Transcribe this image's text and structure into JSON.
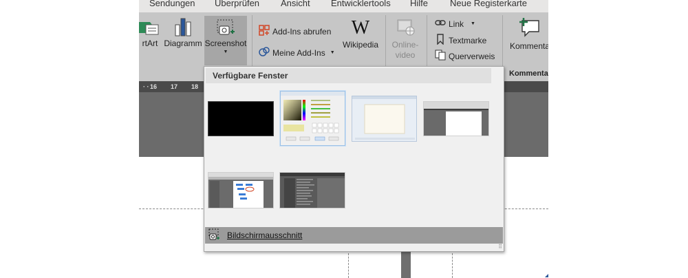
{
  "tabs": [
    "Sendungen",
    "Überprüfen",
    "Ansicht",
    "Entwicklertools",
    "Hilfe",
    "Neue Registerkarte"
  ],
  "ribbon": {
    "smartart_label": "rtArt",
    "diagramm_label": "Diagramm",
    "screenshot_label": "Screenshot",
    "addins_abrufen_label": "Add-Ins abrufen",
    "meine_addins_label": "Meine Add-Ins",
    "wikipedia_label": "Wikipedia",
    "onlinevideo_line1": "Online-",
    "onlinevideo_line2": "video",
    "link_label": "Link",
    "textmarke_label": "Textmarke",
    "querverweis_label": "Querverweis",
    "kommentar_label": "Kommentar",
    "kommentar_group_label": "Kommentar"
  },
  "ruler_ticks": [
    "16",
    "17",
    "18"
  ],
  "dropdown": {
    "header": "Verfügbare Fenster",
    "footer_label": "Bildschirmausschnitt",
    "window_count": 6
  },
  "colors": {
    "ribbon_bg": "#c6c6c6",
    "tab_bar_bg": "#e7e6e5",
    "active_button": "#a6a6a6",
    "dropdown_bg": "#f0f0f0",
    "footer_bg": "#9b9b9b",
    "addin_icon": "#d24726",
    "comment_icon": "#217346"
  }
}
